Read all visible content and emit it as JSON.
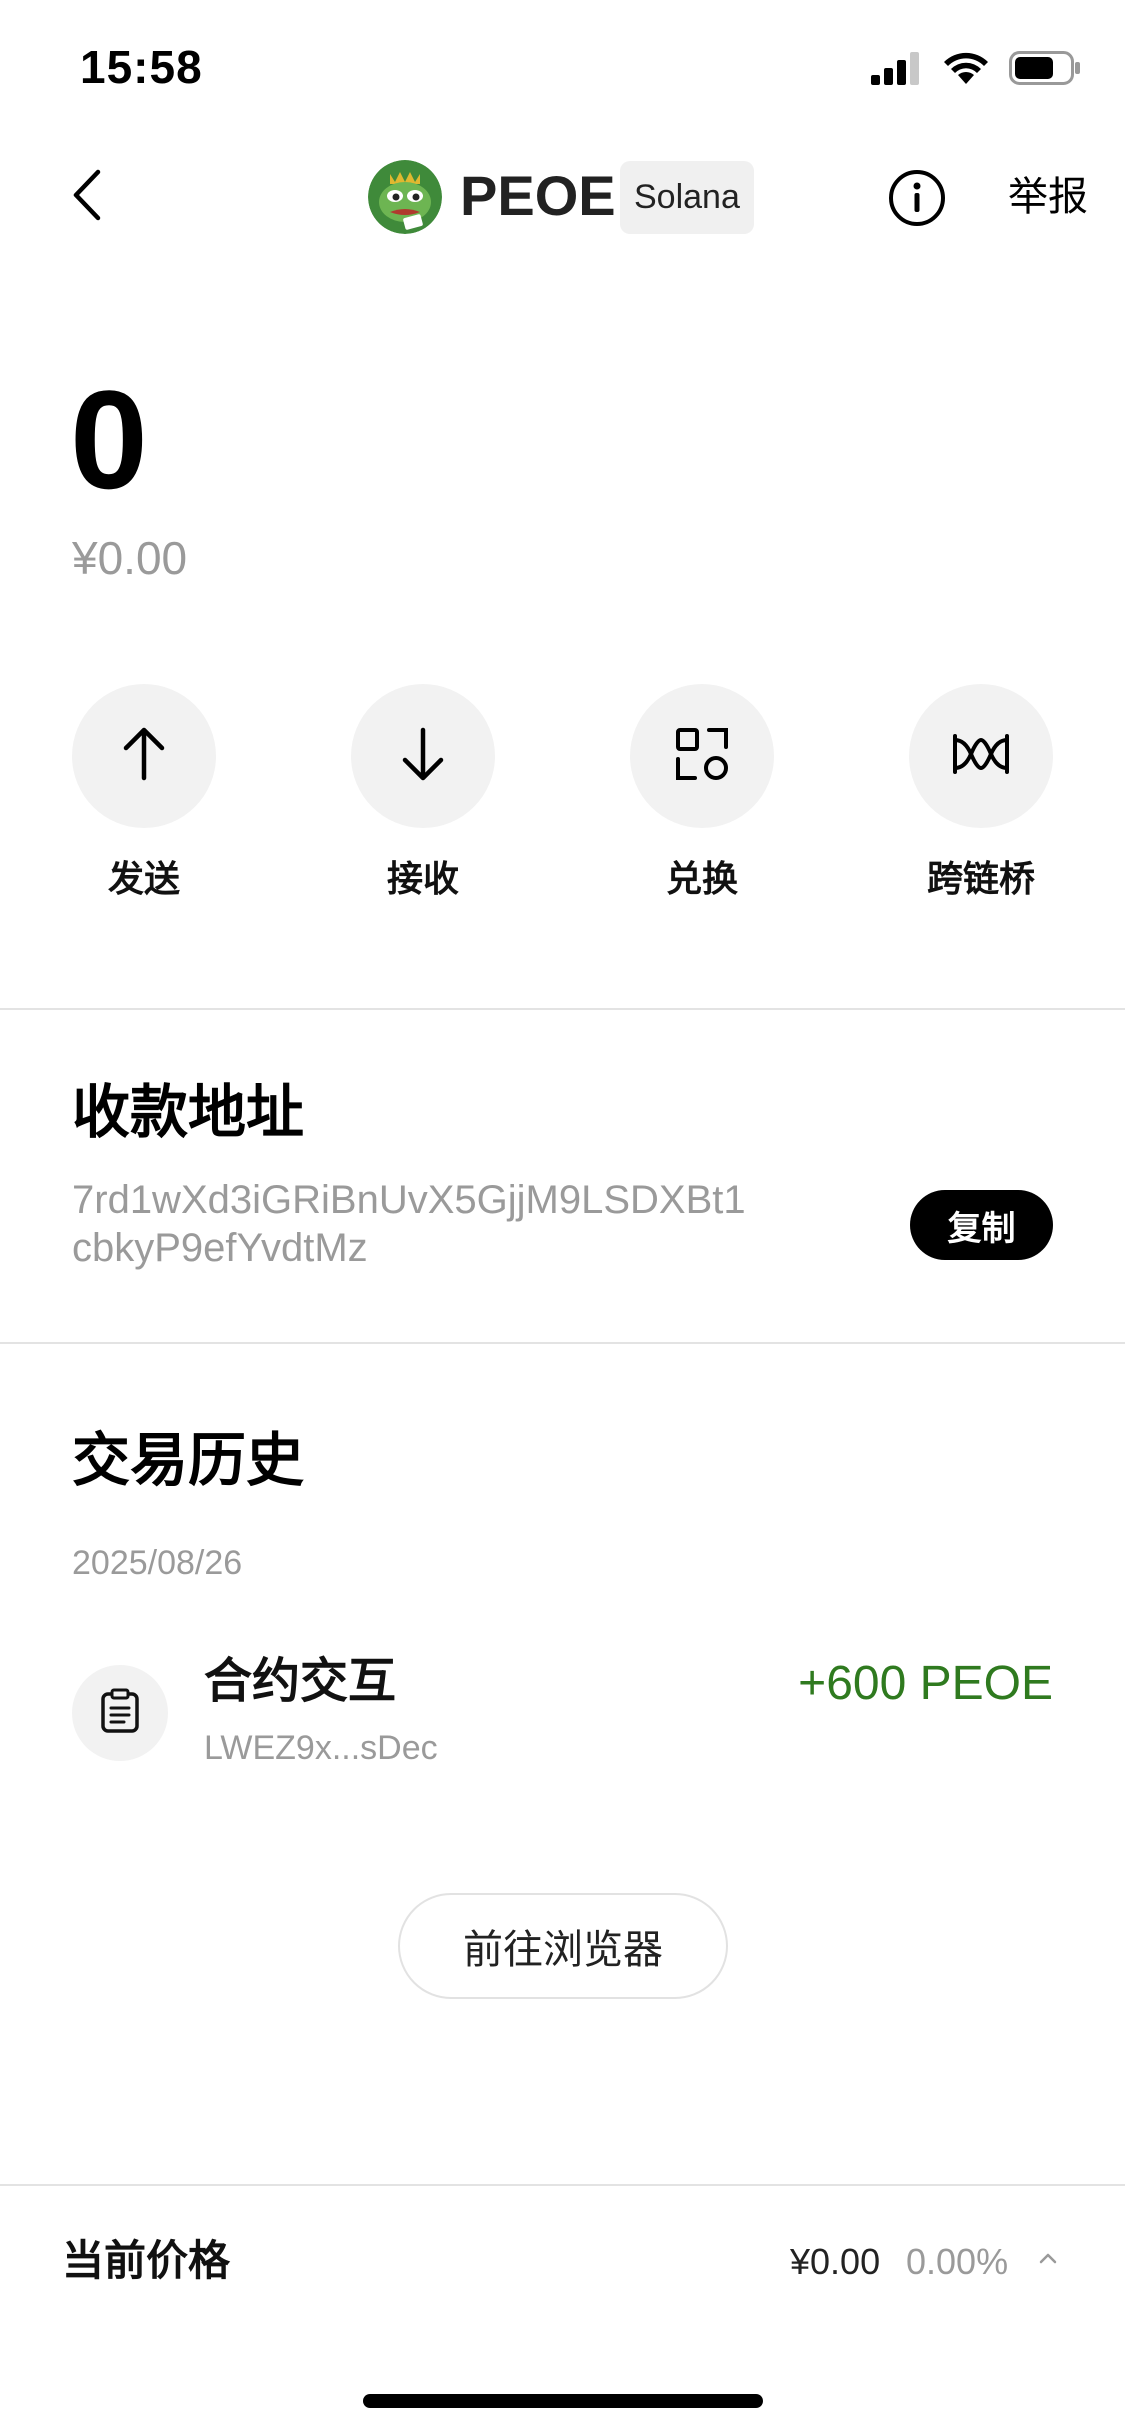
{
  "status_bar": {
    "time": "15:58",
    "icons": [
      "signal-icon",
      "wifi-icon",
      "battery-icon"
    ]
  },
  "header": {
    "back_icon": "chevron-left-icon",
    "token_symbol": "PEOE",
    "chain": "Solana",
    "info_icon": "info-icon",
    "report_label": "举报"
  },
  "balance": {
    "amount": "0",
    "fiat": "¥0.00"
  },
  "actions": [
    {
      "label": "发送",
      "icon": "arrow-up-icon"
    },
    {
      "label": "接收",
      "icon": "arrow-down-icon"
    },
    {
      "label": "兑换",
      "icon": "swap-icon"
    },
    {
      "label": "跨链桥",
      "icon": "bridge-icon"
    }
  ],
  "address_section": {
    "title": "收款地址",
    "address": "7rd1wXd3iGRiBnUvX5GjjM9LSDXBt1cbkyP9efYvdtMz",
    "copy_label": "复制"
  },
  "history": {
    "title": "交易历史",
    "date": "2025/08/26",
    "transactions": [
      {
        "title": "合约交互",
        "subtitle": "LWEZ9x...sDec",
        "amount": "+600 PEOE",
        "icon": "clipboard-icon"
      }
    ],
    "explorer_label": "前往浏览器"
  },
  "bottom_bar": {
    "label": "当前价格",
    "price": "¥0.00",
    "change": "0.00%",
    "chevron_icon": "chevron-up-icon"
  },
  "colors": {
    "positive": "#2f7a1f",
    "muted": "#9a9a9a",
    "button_bg": "#f2f2f2"
  }
}
